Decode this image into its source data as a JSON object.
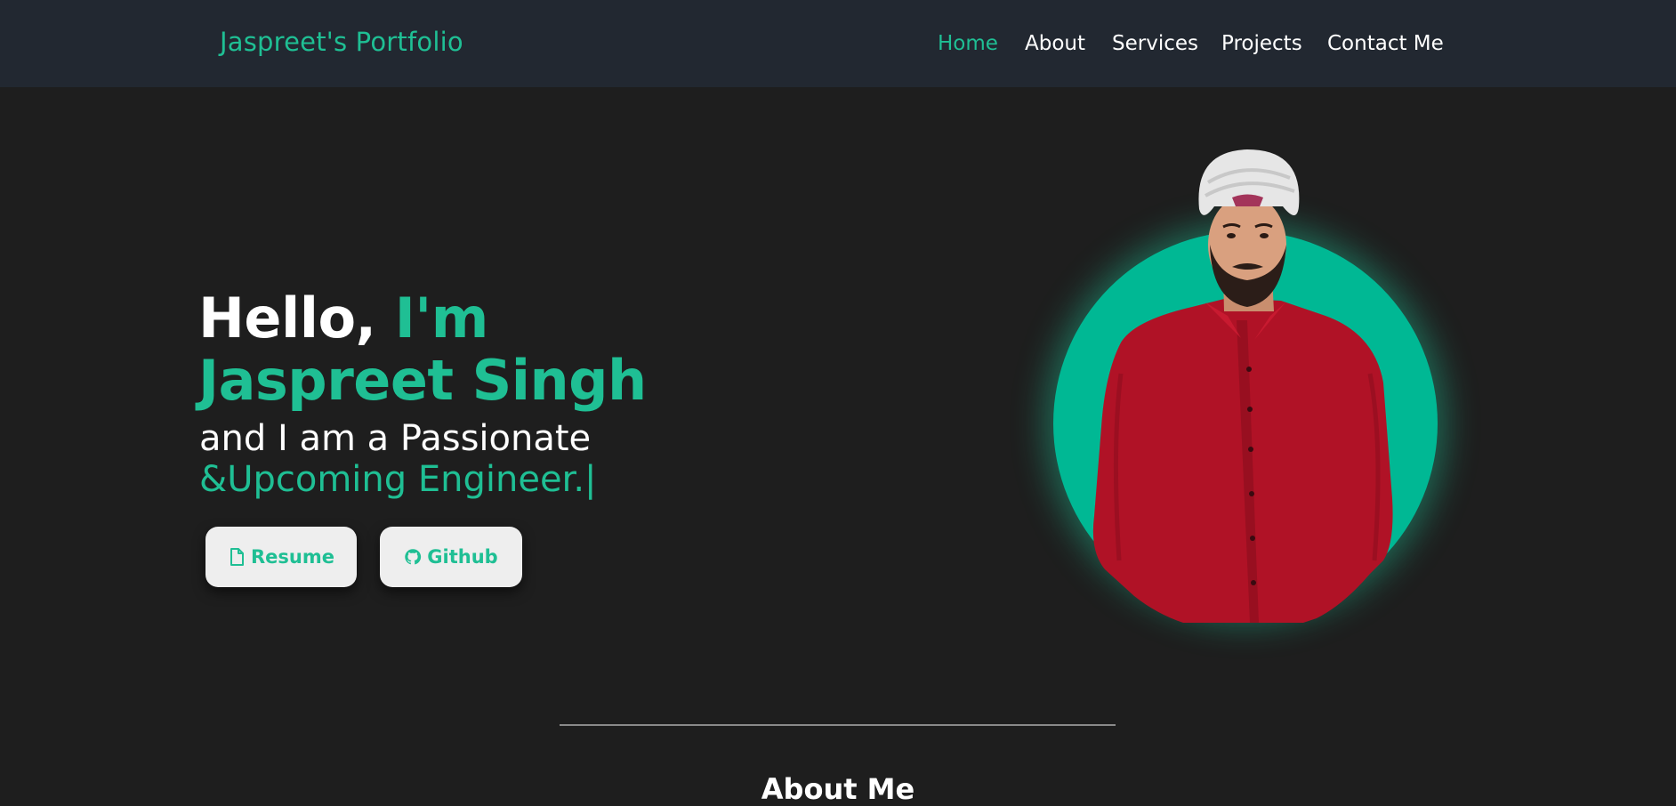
{
  "navbar": {
    "brand": "Jaspreet's Portfolio",
    "links": [
      {
        "label": "Home",
        "active": true
      },
      {
        "label": "About",
        "active": false
      },
      {
        "label": "Services",
        "active": false
      },
      {
        "label": "Projects",
        "active": false
      },
      {
        "label": "Contact Me",
        "active": false
      }
    ]
  },
  "hero": {
    "greeting": "Hello,",
    "im": "I'm",
    "name": "Jaspreet Singh",
    "subline": "and I am a Passionate",
    "typed_text": "&Upcoming Engineer.",
    "cursor": "|",
    "buttons": [
      {
        "label": "Resume",
        "icon": "file-icon"
      },
      {
        "label": "Github",
        "icon": "github-icon"
      }
    ],
    "photo_alt": "profile-photo"
  },
  "about": {
    "heading": "About Me"
  },
  "colors": {
    "accent": "#1fbf94",
    "navbar_bg": "#222831",
    "page_bg": "#1e1e1e",
    "circle": "#00b894",
    "button_bg": "#eeeeee"
  }
}
